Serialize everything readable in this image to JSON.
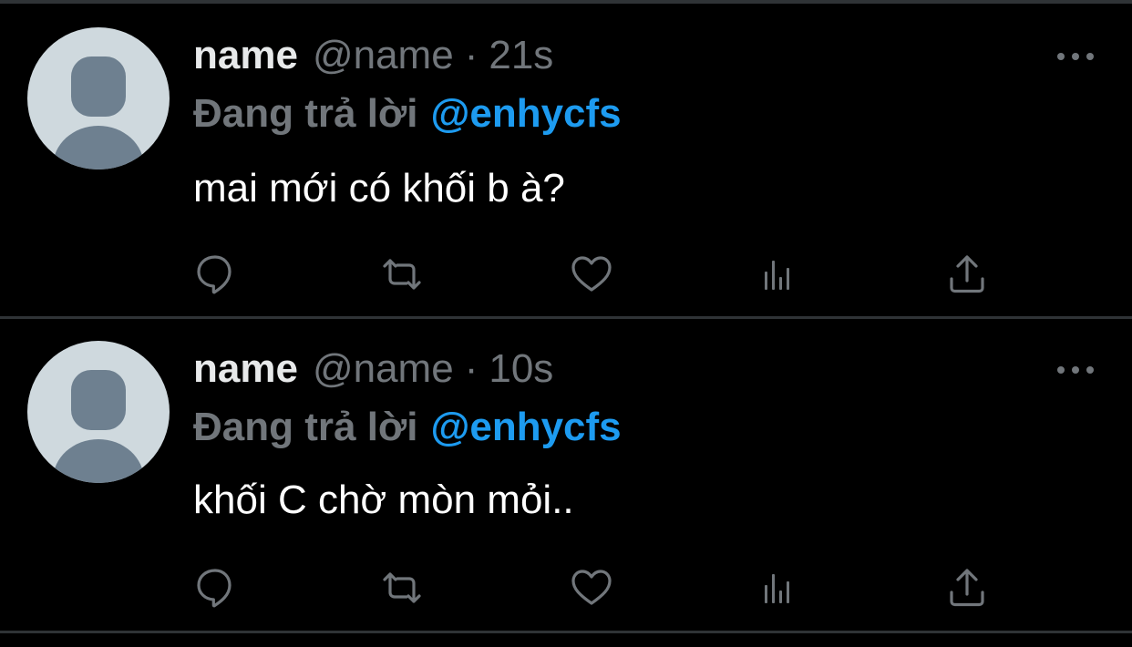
{
  "tweets": [
    {
      "display_name": "name",
      "handle": "@name",
      "separator": "·",
      "time": "21s",
      "reply_label": "Đang trả lời",
      "reply_mention": "@enhycfs",
      "text": "mai mới có khối b à?"
    },
    {
      "display_name": "name",
      "handle": "@name",
      "separator": "·",
      "time": "10s",
      "reply_label": "Đang trả lời",
      "reply_mention": "@enhycfs",
      "text": "khối C chờ mòn mỏi.."
    }
  ],
  "icons": {
    "more": "more-horizontal-icon",
    "reply": "reply-bubble-icon",
    "retweet": "retweet-icon",
    "like": "heart-icon",
    "views": "analytics-bars-icon",
    "share": "share-upload-icon"
  },
  "colors": {
    "background": "#000000",
    "primary_text": "#e7e9ea",
    "secondary_text": "#71767b",
    "mention": "#1d9bf0",
    "divider": "#2f3336",
    "avatar_bg": "#cfd9de",
    "avatar_fg": "#6e8090"
  }
}
